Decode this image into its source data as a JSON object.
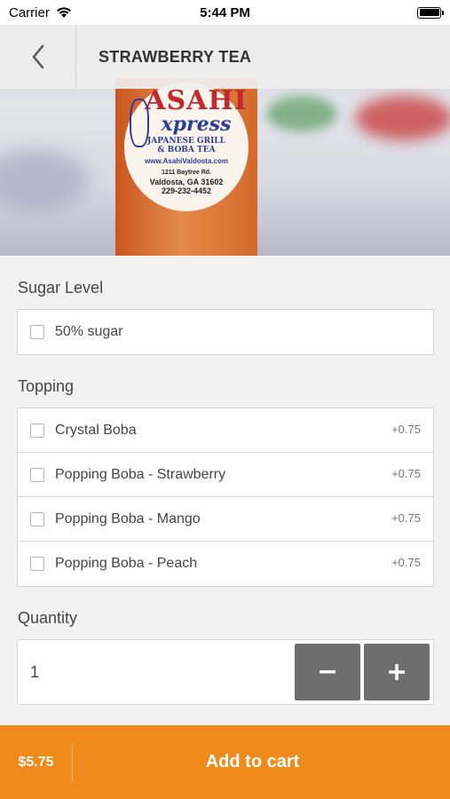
{
  "status_bar": {
    "carrier": "Carrier",
    "time": "5:44 PM"
  },
  "header": {
    "title": "STRAWBERRY TEA"
  },
  "hero": {
    "brand_top": "ASAHI",
    "brand_bottom": "xpress",
    "subtitle_line1": "JAPANESE GRILL",
    "subtitle_line2": "& BOBA TEA",
    "url": "www.AsahiValdosta.com",
    "address_line1": "1211 Baytree Rd.",
    "address_line2": "Valdosta, GA 31602",
    "phone": "229-232-4452"
  },
  "sugar": {
    "title": "Sugar Level",
    "options": [
      {
        "label": "50% sugar",
        "checked": false
      }
    ]
  },
  "topping": {
    "title": "Topping",
    "options": [
      {
        "label": "Crystal Boba",
        "price": "+0.75",
        "checked": false
      },
      {
        "label": "Popping Boba - Strawberry",
        "price": "+0.75",
        "checked": false
      },
      {
        "label": "Popping Boba - Mango",
        "price": "+0.75",
        "checked": false
      },
      {
        "label": "Popping Boba - Peach",
        "price": "+0.75",
        "checked": false
      }
    ]
  },
  "quantity": {
    "title": "Quantity",
    "value": "1",
    "minus_label": "−",
    "plus_label": "+"
  },
  "cart": {
    "price": "$5.75",
    "button_label": "Add to cart"
  },
  "colors": {
    "accent": "#ef8a1b",
    "stepper": "#6e6e6e"
  }
}
